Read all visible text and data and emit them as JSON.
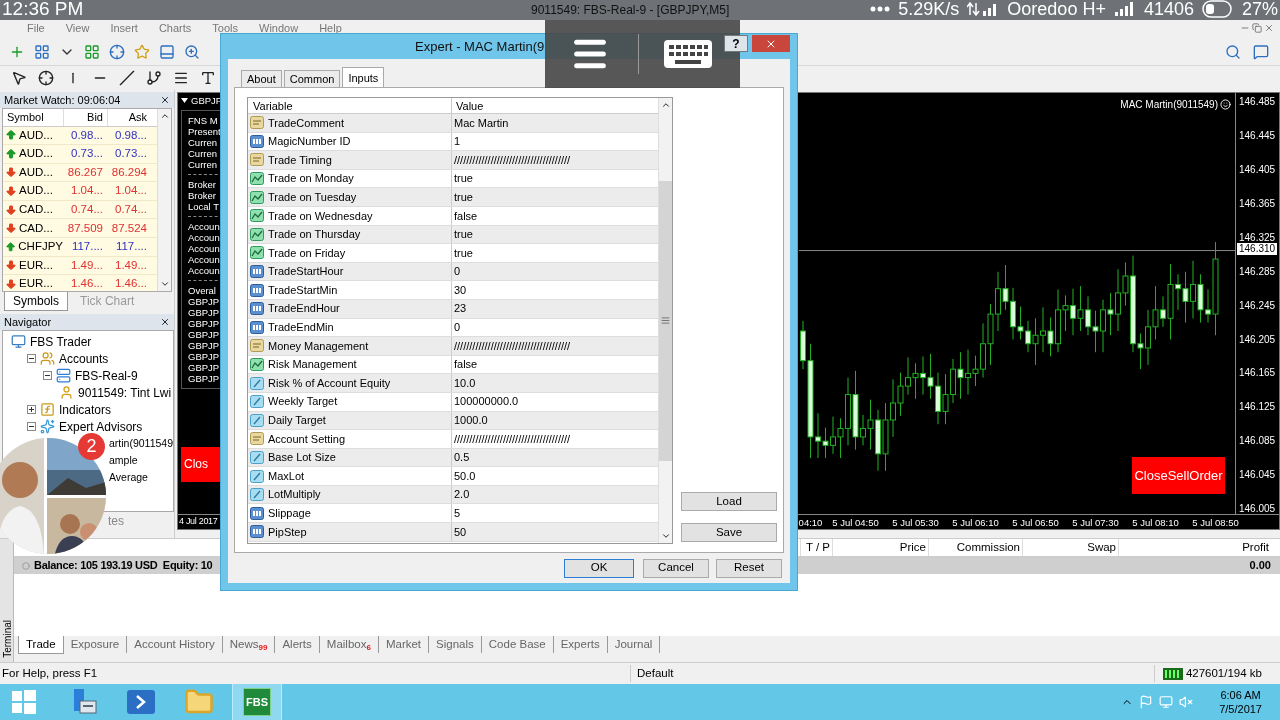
{
  "phone_status": {
    "time": "12:36 PM",
    "speed": "5.29K/s",
    "carrier": "Ooredoo H+",
    "steps": "41406",
    "battery": "27%"
  },
  "window": {
    "title": "9011549: FBS-Real-9 - [GBPJPY,M5]"
  },
  "menu": [
    "File",
    "View",
    "Insert",
    "Charts",
    "Tools",
    "Window",
    "Help"
  ],
  "market_watch": {
    "title": "Market Watch: 09:06:04",
    "columns": [
      "Symbol",
      "Bid",
      "Ask"
    ],
    "rows": [
      {
        "symbol": "AUD...",
        "bid": "0.98...",
        "ask": "0.98...",
        "rising": true
      },
      {
        "symbol": "AUD...",
        "bid": "0.73...",
        "ask": "0.73...",
        "rising": true
      },
      {
        "symbol": "AUD...",
        "bid": "86.267",
        "ask": "86.294",
        "rising": false
      },
      {
        "symbol": "AUD...",
        "bid": "1.04...",
        "ask": "1.04...",
        "rising": false
      },
      {
        "symbol": "CAD...",
        "bid": "0.74...",
        "ask": "0.74...",
        "rising": false
      },
      {
        "symbol": "CAD...",
        "bid": "87.509",
        "ask": "87.524",
        "rising": false
      },
      {
        "symbol": "CHFJPY",
        "bid": "117....",
        "ask": "117....",
        "rising": true
      },
      {
        "symbol": "EUR...",
        "bid": "1.49...",
        "ask": "1.49...",
        "rising": false
      },
      {
        "symbol": "EUR...",
        "bid": "1.46...",
        "ask": "1.46...",
        "rising": false
      }
    ],
    "tabs": [
      {
        "label": "Symbols",
        "selected": true
      },
      {
        "label": "Tick Chart",
        "selected": false
      }
    ]
  },
  "navigator": {
    "title": "Navigator",
    "tab": "tes",
    "tree": [
      {
        "label": "FBS Trader",
        "kind": "terminal",
        "children": [
          {
            "label": "Accounts",
            "kind": "accounts",
            "expanded": true,
            "children": [
              {
                "label": "FBS-Real-9",
                "kind": "server",
                "expanded": true,
                "children": [
                  {
                    "label": "9011549: Tint Lwi",
                    "kind": "user"
                  }
                ]
              }
            ]
          },
          {
            "label": "Indicators",
            "kind": "indicators",
            "expanded": false
          },
          {
            "label": "Expert Advisors",
            "kind": "experts",
            "expanded": true,
            "children": [
              {
                "label": "artin(9011549",
                "kind": "covered"
              },
              {
                "label": "ample",
                "kind": "covered"
              },
              {
                "label": "Average",
                "kind": "covered"
              }
            ]
          }
        ]
      }
    ]
  },
  "chart": {
    "symbol": "GBPJP",
    "info_groups": [
      [
        "FNS M",
        "Present",
        "Curren",
        "Curren",
        "Curren"
      ],
      [
        "Broker",
        "Broker",
        "Local T"
      ],
      [
        "Accoun",
        "Accoun",
        "Accoun",
        "Accoun",
        "Accoun"
      ],
      [
        "Overal",
        "GBPJP",
        "GBPJP",
        "GBPJP",
        "GBPJP",
        "GBPJP",
        "GBPJP",
        "GBPJP",
        "GBPJP"
      ]
    ],
    "close_button": "Clos",
    "expert_label": "MAC Martin(9011549)",
    "close_sell_button": "CloseSellOrder",
    "start_date": "4 Jul 2017",
    "current_price": "146.310",
    "chart_data": {
      "type": "candlestick",
      "ylim": [
        145.999,
        146.496
      ],
      "ref_lines": [
        {
          "axis": "y",
          "value": 146.31
        }
      ],
      "yticks": [
        146.485,
        146.445,
        146.405,
        146.365,
        146.325,
        146.285,
        146.245,
        146.205,
        146.165,
        146.125,
        146.085,
        146.045,
        146.005
      ],
      "categories": [
        null,
        "04:10",
        null,
        null,
        null,
        null,
        null,
        "5 Jul 04:50",
        null,
        null,
        null,
        null,
        null,
        null,
        null,
        "5 Jul 05:30",
        null,
        null,
        null,
        null,
        null,
        null,
        null,
        "5 Jul 06:10",
        null,
        null,
        null,
        null,
        null,
        null,
        null,
        "5 Jul 06:50",
        null,
        null,
        null,
        null,
        null,
        null,
        null,
        "5 Jul 07:30",
        null,
        null,
        null,
        null,
        null,
        null,
        null,
        "5 Jul 08:10",
        null,
        null,
        null,
        null,
        null,
        null,
        null,
        "5 Jul 08:50"
      ],
      "ohlc": [
        [
          146.215,
          146.227,
          146.17,
          146.18
        ],
        [
          146.18,
          146.2,
          146.065,
          146.09
        ],
        [
          146.09,
          146.118,
          146.065,
          146.085
        ],
        [
          146.085,
          146.101,
          146.065,
          146.08
        ],
        [
          146.08,
          146.114,
          146.07,
          146.09
        ],
        [
          146.09,
          146.112,
          146.065,
          146.1
        ],
        [
          146.1,
          146.16,
          146.08,
          146.14
        ],
        [
          146.14,
          146.168,
          146.075,
          146.09
        ],
        [
          146.09,
          146.116,
          146.08,
          146.1
        ],
        [
          146.1,
          146.134,
          146.075,
          146.11
        ],
        [
          146.11,
          146.122,
          146.05,
          146.07
        ],
        [
          146.07,
          146.13,
          146.05,
          146.11
        ],
        [
          146.11,
          146.158,
          146.09,
          146.13
        ],
        [
          146.13,
          146.166,
          146.115,
          146.15
        ],
        [
          146.15,
          146.184,
          146.14,
          146.16
        ],
        [
          146.16,
          146.177,
          146.135,
          146.165
        ],
        [
          146.165,
          146.185,
          146.14,
          146.16
        ],
        [
          146.16,
          146.188,
          146.135,
          146.15
        ],
        [
          146.15,
          146.166,
          146.105,
          146.12
        ],
        [
          146.12,
          146.164,
          146.105,
          146.14
        ],
        [
          146.14,
          146.182,
          146.13,
          146.17
        ],
        [
          146.17,
          146.19,
          146.135,
          146.16
        ],
        [
          146.16,
          146.193,
          146.14,
          146.165
        ],
        [
          146.165,
          146.186,
          146.15,
          146.17
        ],
        [
          146.17,
          146.224,
          146.16,
          146.2
        ],
        [
          146.2,
          146.247,
          146.175,
          146.235
        ],
        [
          146.235,
          146.285,
          146.215,
          146.265
        ],
        [
          146.265,
          146.293,
          146.24,
          146.25
        ],
        [
          146.25,
          146.266,
          146.205,
          146.22
        ],
        [
          146.22,
          146.244,
          146.205,
          146.215
        ],
        [
          146.215,
          146.227,
          146.19,
          146.2
        ],
        [
          146.2,
          146.23,
          146.175,
          146.21
        ],
        [
          146.21,
          146.243,
          146.19,
          146.215
        ],
        [
          146.215,
          146.231,
          146.185,
          146.2
        ],
        [
          146.2,
          146.264,
          146.19,
          146.24
        ],
        [
          146.24,
          146.257,
          146.215,
          146.245
        ],
        [
          146.245,
          146.265,
          146.21,
          146.23
        ],
        [
          146.23,
          146.268,
          146.215,
          146.24
        ],
        [
          146.24,
          146.256,
          146.21,
          146.22
        ],
        [
          146.22,
          146.239,
          146.19,
          146.215
        ],
        [
          146.215,
          146.252,
          146.19,
          146.24
        ],
        [
          146.24,
          146.26,
          146.21,
          146.235
        ],
        [
          146.235,
          146.288,
          146.215,
          146.26
        ],
        [
          146.26,
          146.296,
          146.245,
          146.28
        ],
        [
          146.28,
          146.304,
          146.19,
          146.2
        ],
        [
          146.2,
          146.212,
          146.17,
          146.195
        ],
        [
          146.195,
          146.24,
          146.175,
          146.22
        ],
        [
          146.22,
          146.268,
          146.205,
          146.24
        ],
        [
          146.24,
          146.256,
          146.22,
          146.23
        ],
        [
          146.23,
          146.294,
          146.205,
          146.27
        ],
        [
          146.27,
          146.282,
          146.24,
          146.265
        ],
        [
          146.265,
          146.285,
          146.225,
          146.25
        ],
        [
          146.25,
          146.298,
          146.23,
          146.27
        ],
        [
          146.27,
          146.282,
          146.225,
          146.24
        ],
        [
          146.24,
          146.264,
          146.225,
          146.235
        ],
        [
          146.235,
          146.32,
          146.21,
          146.3
        ]
      ]
    }
  },
  "dialog": {
    "title": "Expert - MAC Martin(9",
    "help_button": "?",
    "tabs": [
      {
        "label": "About",
        "selected": false
      },
      {
        "label": "Common",
        "selected": false
      },
      {
        "label": "Inputs",
        "selected": true
      }
    ],
    "columns": [
      "Variable",
      "Value"
    ],
    "rows": [
      {
        "kind": "string",
        "variable": "TradeComment",
        "value": "Mac Martin"
      },
      {
        "kind": "int",
        "variable": "MagicNumber ID",
        "value": "1"
      },
      {
        "kind": "string",
        "variable": "Trade Timing",
        "value": "//////////////////////////////////////"
      },
      {
        "kind": "bool",
        "variable": "Trade on Monday",
        "value": "true"
      },
      {
        "kind": "bool",
        "variable": "Trade on Tuesday",
        "value": "true"
      },
      {
        "kind": "bool",
        "variable": "Trade on Wednesday",
        "value": "false"
      },
      {
        "kind": "bool",
        "variable": "Trade on Thursday",
        "value": "true"
      },
      {
        "kind": "bool",
        "variable": "Trade on Friday",
        "value": "true"
      },
      {
        "kind": "int",
        "variable": "TradeStartHour",
        "value": "0"
      },
      {
        "kind": "int",
        "variable": "TradeStartMin",
        "value": "30"
      },
      {
        "kind": "int",
        "variable": "TradeEndHour",
        "value": "23"
      },
      {
        "kind": "int",
        "variable": "TradeEndMin",
        "value": "0"
      },
      {
        "kind": "string",
        "variable": "Money Management",
        "value": "//////////////////////////////////////"
      },
      {
        "kind": "bool",
        "variable": "Risk Management",
        "value": "false"
      },
      {
        "kind": "double",
        "variable": "Risk % of Account Equity",
        "value": "10.0"
      },
      {
        "kind": "double",
        "variable": "Weekly Target",
        "value": "100000000.0"
      },
      {
        "kind": "double",
        "variable": "Daily Target",
        "value": "1000.0"
      },
      {
        "kind": "string",
        "variable": "Account Setting",
        "value": "//////////////////////////////////////"
      },
      {
        "kind": "double",
        "variable": "Base Lot Size",
        "value": "0.5"
      },
      {
        "kind": "double",
        "variable": "MaxLot",
        "value": "50.0"
      },
      {
        "kind": "double",
        "variable": "LotMultiply",
        "value": "2.0"
      },
      {
        "kind": "int",
        "variable": "Slippage",
        "value": "5"
      },
      {
        "kind": "int",
        "variable": "PipStep",
        "value": "50"
      }
    ],
    "side_buttons": [
      "Load",
      "Save"
    ],
    "buttons": [
      {
        "label": "OK",
        "default": true
      },
      {
        "label": "Cancel",
        "default": false
      },
      {
        "label": "Reset",
        "default": false
      }
    ]
  },
  "terminal": {
    "label": "Terminal",
    "columns": [
      "T / P",
      "Price",
      "Commission",
      "Swap",
      "Profit"
    ],
    "balance": "Balance: 105 193.19 USD  Equity: 10",
    "profit": "0.00",
    "tabs": [
      {
        "label": "Trade",
        "selected": true
      },
      {
        "label": "Exposure",
        "selected": false
      },
      {
        "label": "Account History",
        "selected": false
      },
      {
        "label": "News",
        "badge": "99",
        "selected": false
      },
      {
        "label": "Alerts",
        "selected": false
      },
      {
        "label": "Mailbox",
        "badge": "6",
        "selected": false
      },
      {
        "label": "Market",
        "selected": false
      },
      {
        "label": "Signals",
        "selected": false
      },
      {
        "label": "Code Base",
        "selected": false
      },
      {
        "label": "Experts",
        "selected": false
      },
      {
        "label": "Journal",
        "selected": false
      }
    ]
  },
  "status_bar": {
    "help": "For Help, press F1",
    "profile": "Default",
    "traffic": "427601/194 kb"
  },
  "taskbar": {
    "apps": [
      {
        "kind": "server"
      },
      {
        "kind": "powershell"
      },
      {
        "kind": "explorer"
      },
      {
        "kind": "fbs",
        "label": "FBS",
        "selected": true
      }
    ],
    "time": "6:06 AM",
    "date": "7/5/2017"
  },
  "chat_head": {
    "badge": "2"
  }
}
